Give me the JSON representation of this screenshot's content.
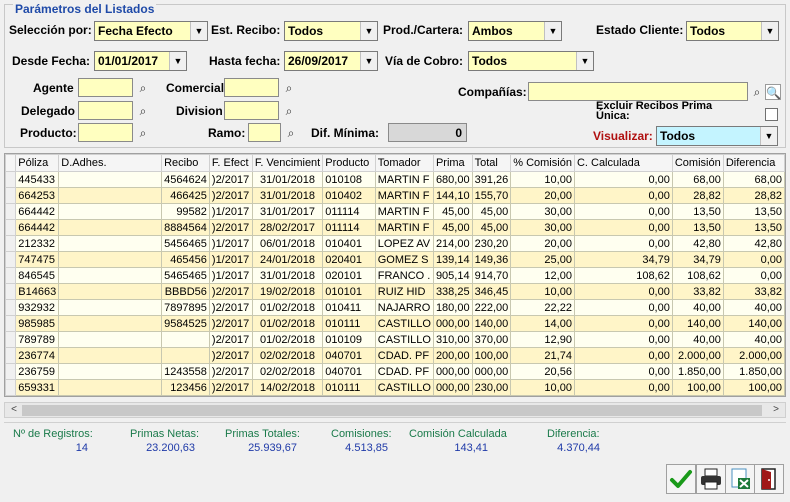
{
  "params": {
    "legend": "Parámetros del Listados",
    "seleccion_label": "Selección por:",
    "seleccion_value": "Fecha Efecto",
    "est_recibo_label": "Est. Recibo:",
    "est_recibo_value": "Todos",
    "prod_cartera_label": "Prod./Cartera:",
    "prod_cartera_value": "Ambos",
    "estado_cliente_label": "Estado Cliente:",
    "estado_cliente_value": "Todos",
    "desde_label": "Desde Fecha:",
    "desde_value": "01/01/2017",
    "hasta_label": "Hasta fecha:",
    "hasta_value": "26/09/2017",
    "via_cobro_label": "Vía de Cobro:",
    "via_cobro_value": "Todos",
    "agente_label": "Agente",
    "comercial_label": "Comercial",
    "companias_label": "Compañías:",
    "delegado_label": "Delegado",
    "division_label": "Division",
    "excluir_label": "Excluir Recibos Prima Única:",
    "producto_label": "Producto:",
    "ramo_label": "Ramo:",
    "dif_minima_label": "Dif. Mínima:",
    "dif_minima_value": "0",
    "visualizar_label": "Visualizar:",
    "visualizar_value": "Todos"
  },
  "grid": {
    "headers": [
      "Póliza",
      "D.Adhes.",
      "Recibo",
      "F. Efect",
      "F. Vencimient",
      "Producto",
      "Tomador",
      "Prima",
      "Total",
      "% Comisión",
      "C. Calculada",
      "Comisión",
      "Diferencia"
    ],
    "rows": [
      [
        "445433",
        "",
        "4564624",
        ")2/2017",
        "31/01/2018",
        "010108",
        "MARTIN F",
        "680,00",
        "391,26",
        "10,00",
        "0,00",
        "68,00",
        "68,00"
      ],
      [
        "664253",
        "",
        "466425",
        ")2/2017",
        "31/01/2018",
        "010402",
        "MARTIN F",
        "144,10",
        "155,70",
        "20,00",
        "0,00",
        "28,82",
        "28,82"
      ],
      [
        "664442",
        "",
        "99582",
        ")1/2017",
        "31/01/2017",
        "011114",
        "MARTIN F",
        "45,00",
        "45,00",
        "30,00",
        "0,00",
        "13,50",
        "13,50"
      ],
      [
        "664442",
        "",
        "8884564",
        ")2/2017",
        "28/02/2017",
        "011114",
        "MARTIN F",
        "45,00",
        "45,00",
        "30,00",
        "0,00",
        "13,50",
        "13,50"
      ],
      [
        "212332",
        "",
        "5456465",
        ")1/2017",
        "06/01/2018",
        "010401",
        "LOPEZ AV",
        "214,00",
        "230,20",
        "20,00",
        "0,00",
        "42,80",
        "42,80"
      ],
      [
        "747475",
        "",
        "465456",
        ")1/2017",
        "24/01/2018",
        "020401",
        "GOMEZ S",
        "139,14",
        "149,36",
        "25,00",
        "34,79",
        "34,79",
        "0,00"
      ],
      [
        "846545",
        "",
        "5465465",
        ")1/2017",
        "31/01/2018",
        "020101",
        "FRANCO .",
        "905,14",
        "914,70",
        "12,00",
        "108,62",
        "108,62",
        "0,00"
      ],
      [
        "B14663",
        "",
        "BBBD56",
        ")2/2017",
        "19/02/2018",
        "010101",
        "RUIZ HID",
        "338,25",
        "346,45",
        "10,00",
        "0,00",
        "33,82",
        "33,82"
      ],
      [
        "932932",
        "",
        "7897895",
        ")2/2017",
        "01/02/2018",
        "010411",
        "NAJARRO",
        "180,00",
        "222,00",
        "22,22",
        "0,00",
        "40,00",
        "40,00"
      ],
      [
        "985985",
        "",
        "9584525",
        ")2/2017",
        "01/02/2018",
        "010111",
        "CASTILLO",
        "000,00",
        "140,00",
        "14,00",
        "0,00",
        "140,00",
        "140,00"
      ],
      [
        "789789",
        "",
        "",
        ")2/2017",
        "01/02/2018",
        "010109",
        "CASTILLO",
        "310,00",
        "370,00",
        "12,90",
        "0,00",
        "40,00",
        "40,00"
      ],
      [
        "236774",
        "",
        "",
        ")2/2017",
        "02/02/2018",
        "040701",
        "CDAD. PF",
        "200,00",
        "100,00",
        "21,74",
        "0,00",
        "2.000,00",
        "2.000,00"
      ],
      [
        "236759",
        "",
        "1243558",
        ")2/2017",
        "02/02/2018",
        "040701",
        "CDAD. PF",
        "000,00",
        "000,00",
        "20,56",
        "0,00",
        "1.850,00",
        "1.850,00"
      ],
      [
        "659331",
        "",
        "123456",
        ")2/2017",
        "14/02/2018",
        "010111",
        "CASTILLO",
        "000,00",
        "230,00",
        "10,00",
        "0,00",
        "100,00",
        "100,00"
      ]
    ]
  },
  "totals": [
    {
      "label": "Nº de Registros:",
      "value": "14"
    },
    {
      "label": "Primas Netas:",
      "value": "23.200,63"
    },
    {
      "label": "Primas Totales:",
      "value": "25.939,67"
    },
    {
      "label": "Comisiones:",
      "value": "4.513,85"
    },
    {
      "label": "Comisión Calculada",
      "value": "143,41"
    },
    {
      "label": "Diferencia:",
      "value": "4.370,44"
    }
  ],
  "colors": {
    "field": "#ffffc0",
    "accent": "#1f4aa8",
    "visualizar_label": "#b01010",
    "totals_label": "#1a7a4a"
  },
  "icons": {
    "search": "binoculars-icon",
    "accept": "check-icon",
    "print": "printer-icon",
    "excel": "excel-icon",
    "exit": "exit-door-icon"
  }
}
